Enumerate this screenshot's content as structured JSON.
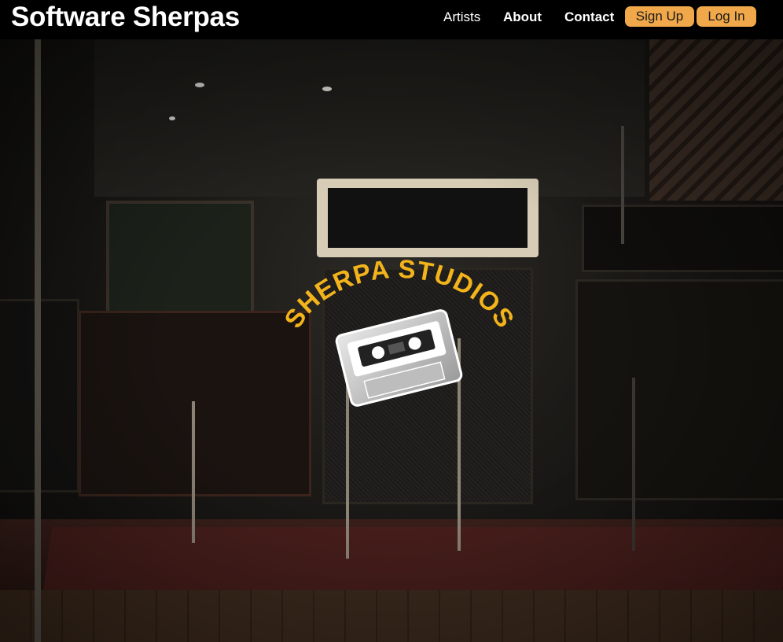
{
  "navbar": {
    "brand": "Software Sherpas",
    "links": {
      "artists": "Artists",
      "about": "About",
      "contact": "Contact"
    },
    "buttons": {
      "signup": "Sign Up",
      "login": "Log In"
    },
    "accent_color": "#f0a84a"
  },
  "hero": {
    "background": "music-studio-amplifiers-photo",
    "logo": {
      "text": "SHERPA STUDIOS",
      "icon": "cassette-tape-icon",
      "text_color": "#f2b31b"
    }
  }
}
